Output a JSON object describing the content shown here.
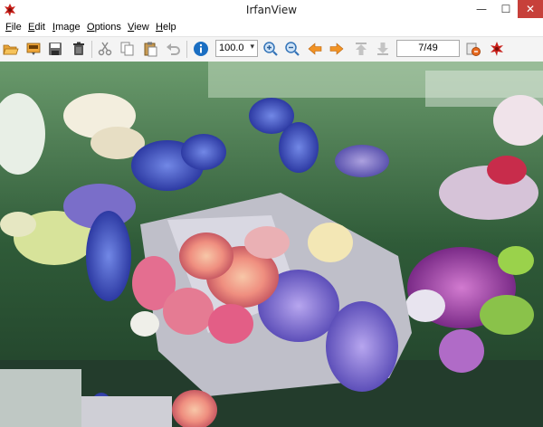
{
  "window": {
    "title": "IrfanView",
    "minimize_glyph": "—",
    "maximize_glyph": "☐",
    "close_glyph": "✕"
  },
  "menu": {
    "items": [
      {
        "label": "File",
        "access_key": "F",
        "rest": "ile"
      },
      {
        "label": "Edit",
        "access_key": "E",
        "rest": "dit"
      },
      {
        "label": "Image",
        "access_key": "I",
        "rest": "mage"
      },
      {
        "label": "Options",
        "access_key": "O",
        "rest": "ptions"
      },
      {
        "label": "View",
        "access_key": "V",
        "rest": "iew"
      },
      {
        "label": "Help",
        "access_key": "H",
        "rest": "elp"
      }
    ]
  },
  "toolbar": {
    "icons": [
      "open-folder-icon",
      "slideshow-icon",
      "save-icon",
      "delete-icon",
      "cut-icon",
      "copy-icon",
      "paste-icon",
      "undo-icon",
      "info-icon",
      "zoom-in-icon",
      "zoom-out-icon",
      "previous-icon",
      "next-icon",
      "first-icon",
      "last-icon",
      "settings-icon",
      "paint-icon"
    ],
    "zoom_value": "100.0",
    "page_counter": "7/49"
  },
  "viewer": {
    "subject": "flower shop bouquet photo"
  },
  "colors": {
    "accent_orange": "#f19325",
    "info_blue": "#1a6ec2",
    "close_red": "#c7403a"
  }
}
